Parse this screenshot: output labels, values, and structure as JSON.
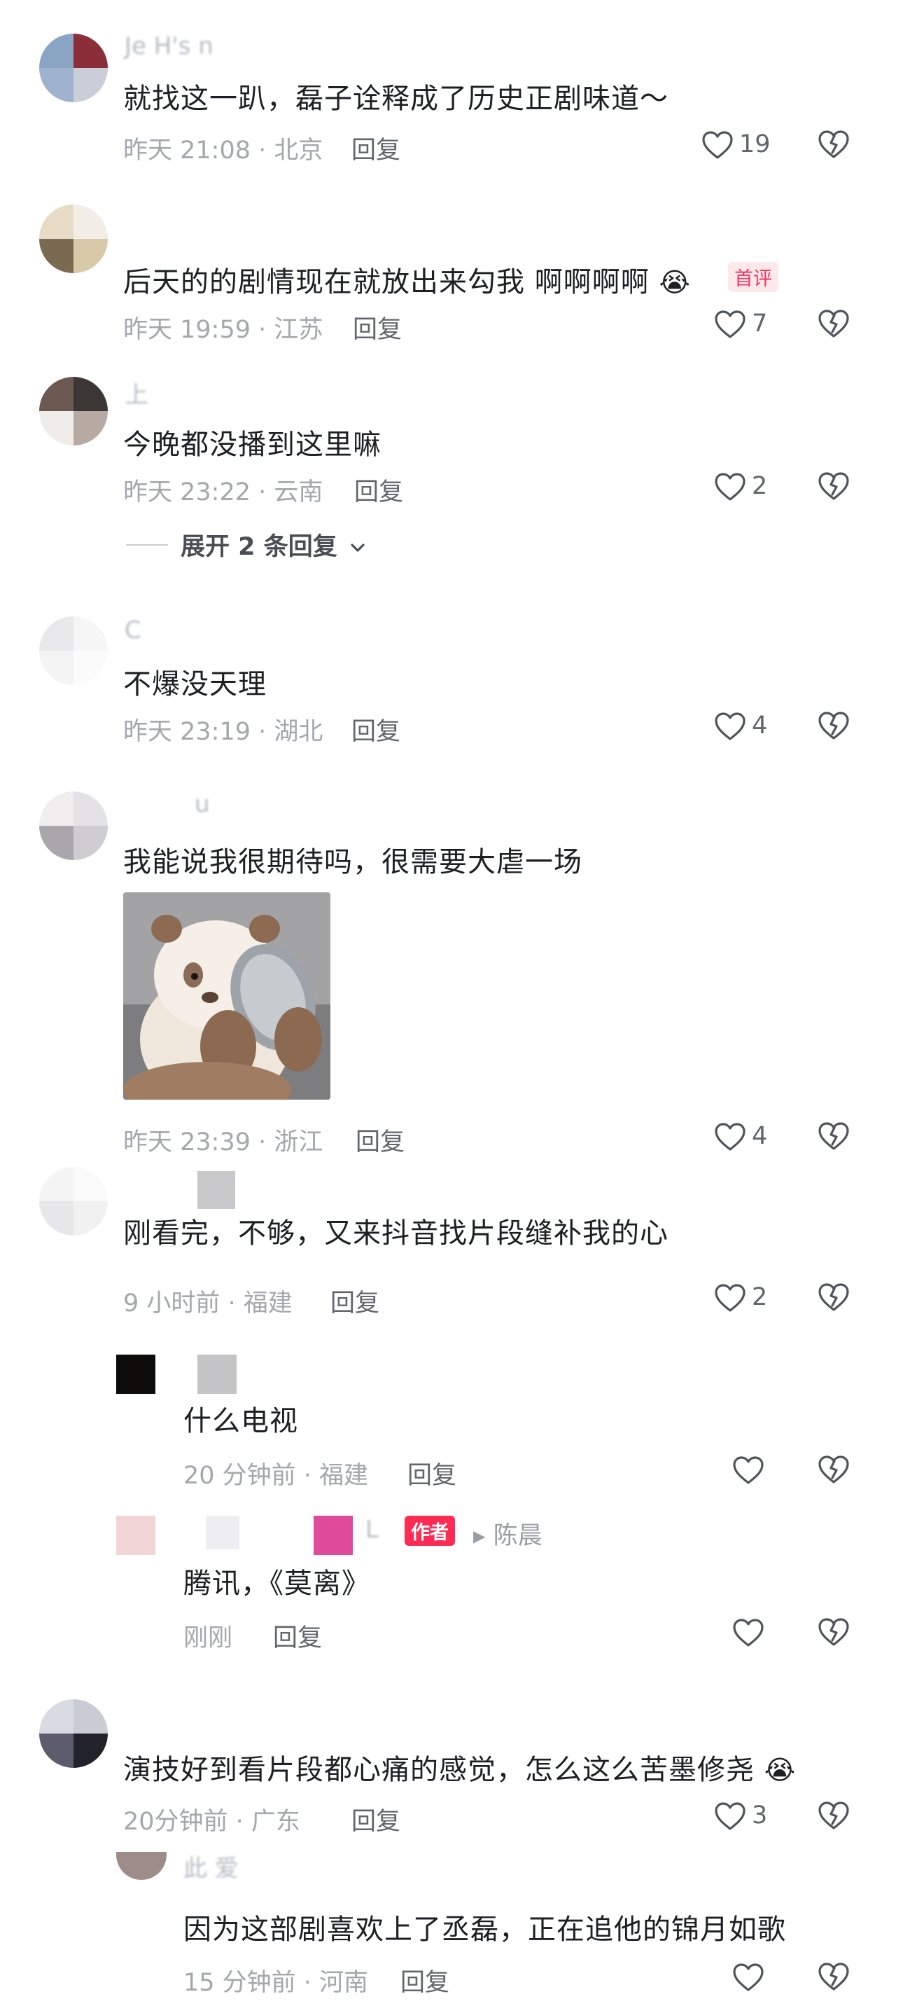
{
  "comments": [
    {
      "name": "Je    H's    n",
      "text": "就找这一趴，磊子诠释成了历史正剧味道～",
      "meta": "昨天 21:08 · 北京",
      "reply": "回复",
      "likes": "19"
    },
    {
      "name": "",
      "text": "后天的的剧情现在就放出来勾我 啊啊啊啊",
      "emoji": "😭",
      "badge": "首评",
      "meta": "昨天 19:59 · 江苏",
      "reply": "回复",
      "likes": "7"
    },
    {
      "name": "上",
      "text": "今晚都没播到这里嘛",
      "meta": "昨天 23:22 · 云南",
      "reply": "回复",
      "likes": "2",
      "expand": "展开 2 条回复"
    },
    {
      "name": "C",
      "text": "不爆没天理",
      "meta": "昨天 23:19 · 湖北",
      "reply": "回复",
      "likes": "4"
    },
    {
      "name": "u",
      "text": "我能说我很期待吗，很需要大虐一场",
      "meta": "昨天 23:39 · 浙江",
      "reply": "回复",
      "likes": "4",
      "image": "panda-sticker"
    },
    {
      "name": "",
      "text": "刚看完，不够，又来抖音找片段缝补我的心",
      "meta": "9 小时前 · 福建",
      "reply": "回复",
      "likes": "2"
    },
    {
      "name": "",
      "text": "演技好到看片段都心痛的感觉，怎么这么苦墨修尧",
      "emoji": "😭",
      "meta": "20分钟前 · 广东",
      "reply": "回复",
      "likes": "3"
    }
  ],
  "replies": [
    {
      "name": "",
      "text": "什么电视",
      "meta": "20 分钟前 · 福建",
      "reply": "回复",
      "likes": ""
    },
    {
      "name": "L",
      "author_badge": "作者",
      "reply_to": "▸ 陈晨",
      "text": "腾讯，《莫离》",
      "meta": "刚刚",
      "reply": "回复",
      "likes": ""
    },
    {
      "name": "此    爱",
      "text": "因为这部剧喜欢上了丞磊，正在追他的锦月如歌",
      "meta": "15 分钟前 · 河南",
      "reply": "回复",
      "likes": ""
    }
  ],
  "colors": {
    "text": "#1c1f23",
    "meta": "#a4a7ad",
    "badge_first": "#f0385c",
    "badge_author": "#fe2c55"
  },
  "icons": {
    "like": "heart-icon",
    "dislike": "broken-heart-icon",
    "expand": "chevron-down-icon"
  }
}
